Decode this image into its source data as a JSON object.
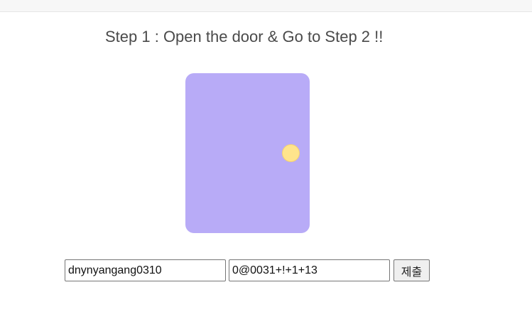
{
  "heading": "Step 1 : Open the door & Go to Step 2 !!",
  "door": {
    "color": "#b8abf7",
    "knob_color": "#ffe48c"
  },
  "form": {
    "id_value": "dnynyangang0310",
    "pw_value": "0@0031+!+1+13",
    "submit_label": "제출"
  }
}
